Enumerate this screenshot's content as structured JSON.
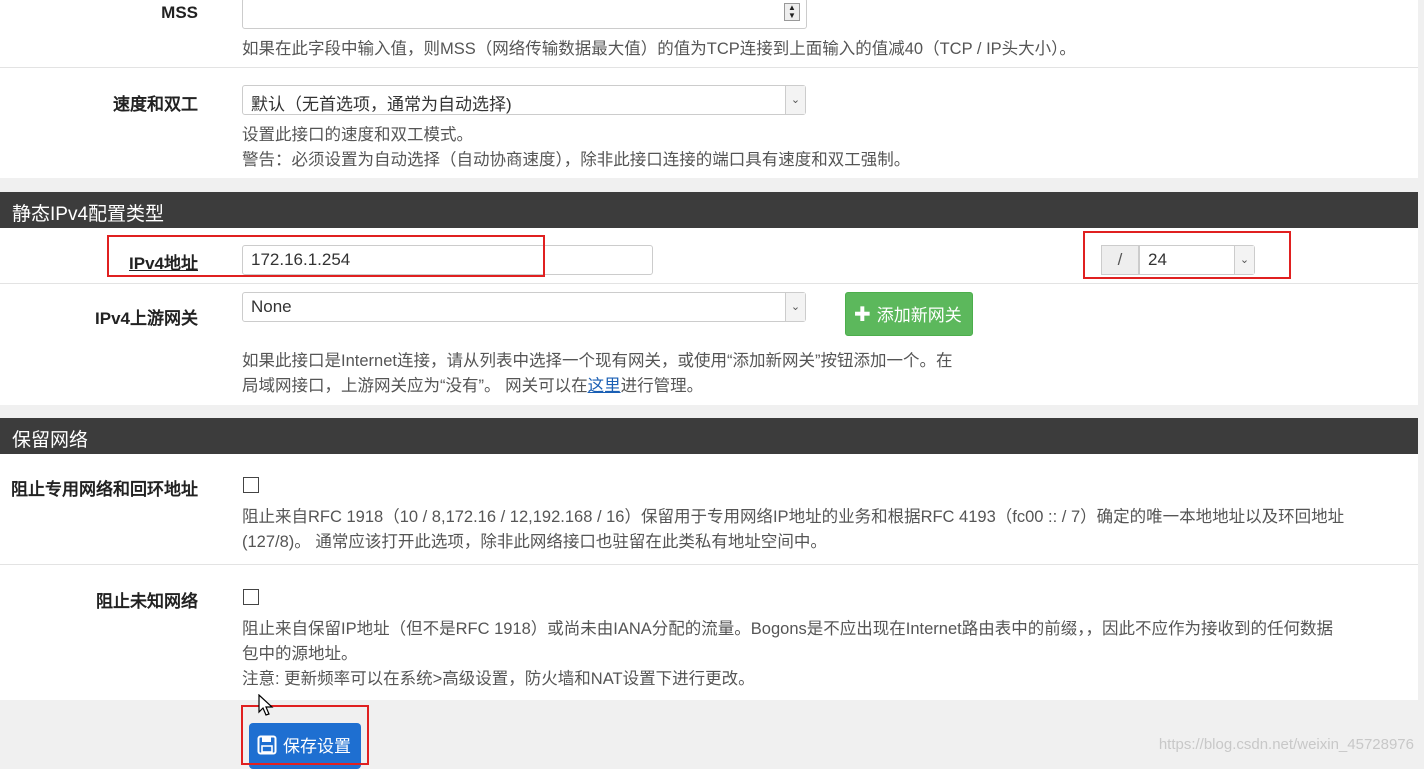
{
  "mss": {
    "label": "MSS",
    "value": "",
    "help": "如果在此字段中输入值，则MSS（网络传输数据最大值）的值为TCP连接到上面输入的值减40（TCP / IP头大小）。"
  },
  "speed": {
    "label": "速度和双工",
    "selected": "默认（无首选项，通常为自动选择)",
    "help1": "设置此接口的速度和双工模式。",
    "help2": "警告：必须设置为自动选择（自动协商速度），除非此接口连接的端口具有速度和双工强制。"
  },
  "ipv4_section": {
    "title": "静态IPv4配置类型",
    "address_label": "IPv4地址",
    "address_value": "172.16.1.254",
    "slash": "/",
    "cidr": "24",
    "gateway_label": "IPv4上游网关",
    "gateway_selected": "None",
    "add_gateway_label": "添加新网关",
    "help_line1": "如果此接口是Internet连接，请从列表中选择一个现有网关，或使用“添加新网关”按钮添加一个。在",
    "help_line2_pre": "局域网接口，上游网关应为“没有”。 网关可以在",
    "help_link": "这里",
    "help_line2_post": "进行管理。"
  },
  "reserved_section": {
    "title": "保留网络",
    "private_label": "阻止专用网络和回环地址",
    "private_help1": "阻止来自RFC 1918（10 / 8,172.16 / 12,192.168 / 16）保留用于专用网络IP地址的业务和根据RFC 4193（fc00 :: / 7）确定的唯一本地地址以及环回地址",
    "private_help2": "(127/8)。 通常应该打开此选项，除非此网络接口也驻留在此类私有地址空间中。",
    "bogon_label": "阻止未知网络",
    "bogon_help1": "阻止来自保留IP地址（但不是RFC 1918）或尚未由IANA分配的流量。Bogons是不应出现在Internet路由表中的前缀，，因此不应作为接收到的任何数据",
    "bogon_help2": "包中的源地址。",
    "bogon_help3": "注意: 更新频率可以在系统>高级设置，防火墙和NAT设置下进行更改。"
  },
  "save_label": "保存设置",
  "watermark": "https://blog.csdn.net/weixin_45728976",
  "icons": [
    "spinner-icon",
    "chevron-down-icon",
    "plus-icon",
    "save-icon",
    "cursor-icon"
  ],
  "colors": {
    "accent_green": "#5cb85c",
    "accent_blue": "#1e6fd1",
    "highlight_red": "#e02020",
    "section_bg": "#3c3c3c"
  }
}
